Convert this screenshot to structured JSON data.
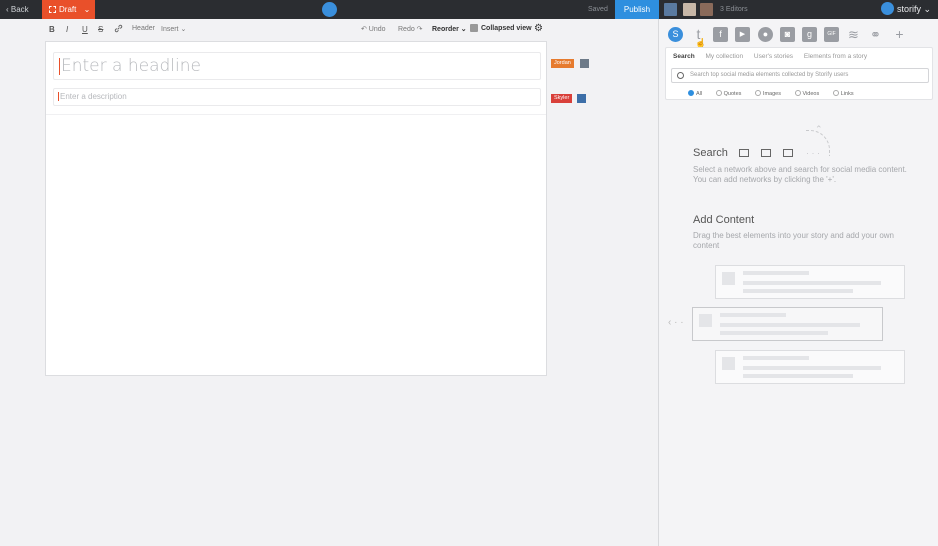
{
  "topbar": {
    "back_label": "‹ Back",
    "draft_label": "Draft",
    "draft_chevron": "⌄",
    "saved_label": "Saved",
    "publish_label": "Publish",
    "editors_label": "3 Editors",
    "brand_label": "storify",
    "brand_chevron": "⌄"
  },
  "toolbar": {
    "bold": "B",
    "italic": "I",
    "underline": "U",
    "strike": "S",
    "link_icon": "link-icon",
    "header_label": "Header",
    "insert_label": "Insert ⌄",
    "undo_label": "↶ Undo",
    "redo_label": "Redo ↷",
    "reorder_label": "Reorder ⌄",
    "collapsed_label": "Collapsed view",
    "settings_icon": "gear-icon"
  },
  "editor": {
    "headline_placeholder": "Enter a headline",
    "description_placeholder": "Enter a description",
    "tag_jordan": "Jordan",
    "tag_skyler": "Skyler"
  },
  "networks": [
    {
      "name": "storify-icon",
      "glyph": "S"
    },
    {
      "name": "twitter-icon",
      "glyph": "t"
    },
    {
      "name": "facebook-icon",
      "glyph": "f"
    },
    {
      "name": "youtube-icon",
      "glyph": "▶"
    },
    {
      "name": "flickr-icon",
      "glyph": "●"
    },
    {
      "name": "instagram-icon",
      "glyph": "◙"
    },
    {
      "name": "google-plus-icon",
      "glyph": "g"
    },
    {
      "name": "gif-icon",
      "glyph": "GIF"
    },
    {
      "name": "rss-icon",
      "glyph": "≋"
    },
    {
      "name": "link-icon",
      "glyph": "⚭"
    },
    {
      "name": "add-icon",
      "glyph": "+"
    }
  ],
  "search": {
    "tabs": [
      "Search",
      "My collection",
      "User's stories",
      "Elements from a story"
    ],
    "placeholder": "Search top social media elements collected by Storify users",
    "filters": [
      "All",
      "Quotes",
      "Images",
      "Videos",
      "Links"
    ]
  },
  "helper": {
    "search_title": "Search",
    "search_text": "Select a network above and search for social media content. You can add networks by clicking the '+'.",
    "add_title": "Add Content",
    "add_text": "Drag the best elements into your story and add your own content"
  },
  "colors": {
    "accent": "#e9502a",
    "publish": "#2e8fdf",
    "topbar": "#2b2d31"
  }
}
